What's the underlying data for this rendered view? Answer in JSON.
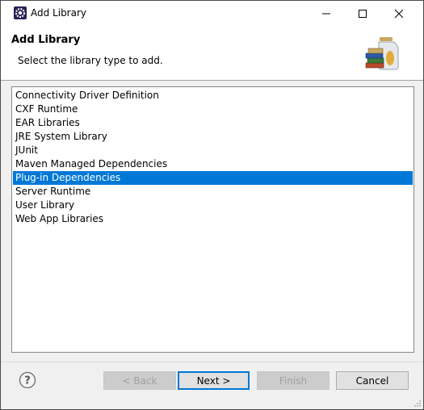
{
  "window": {
    "title": "Add Library",
    "controls": {
      "minimize": "—",
      "maximize": "☐",
      "close": "✕"
    }
  },
  "header": {
    "title": "Add Library",
    "message": "Select the library type to add."
  },
  "library_types": [
    {
      "label": "Connectivity Driver Definition",
      "selected": false
    },
    {
      "label": "CXF Runtime",
      "selected": false
    },
    {
      "label": "EAR Libraries",
      "selected": false
    },
    {
      "label": "JRE System Library",
      "selected": false
    },
    {
      "label": "JUnit",
      "selected": false
    },
    {
      "label": "Maven Managed Dependencies",
      "selected": false
    },
    {
      "label": "Plug-in Dependencies",
      "selected": true
    },
    {
      "label": "Server Runtime",
      "selected": false
    },
    {
      "label": "User Library",
      "selected": false
    },
    {
      "label": "Web App Libraries",
      "selected": false
    }
  ],
  "buttons": {
    "back": {
      "label": "< Back",
      "enabled": false
    },
    "next": {
      "label": "Next >",
      "enabled": true
    },
    "finish": {
      "label": "Finish",
      "enabled": false
    },
    "cancel": {
      "label": "Cancel",
      "enabled": true
    }
  },
  "icons": {
    "app": "eclipse-gear-icon",
    "help": "help-icon",
    "header": "library-jar-books-icon"
  },
  "colors": {
    "selection": "#0078d7",
    "window_border": "#4a4a4a",
    "dialog_bg": "#f0f0f0"
  }
}
